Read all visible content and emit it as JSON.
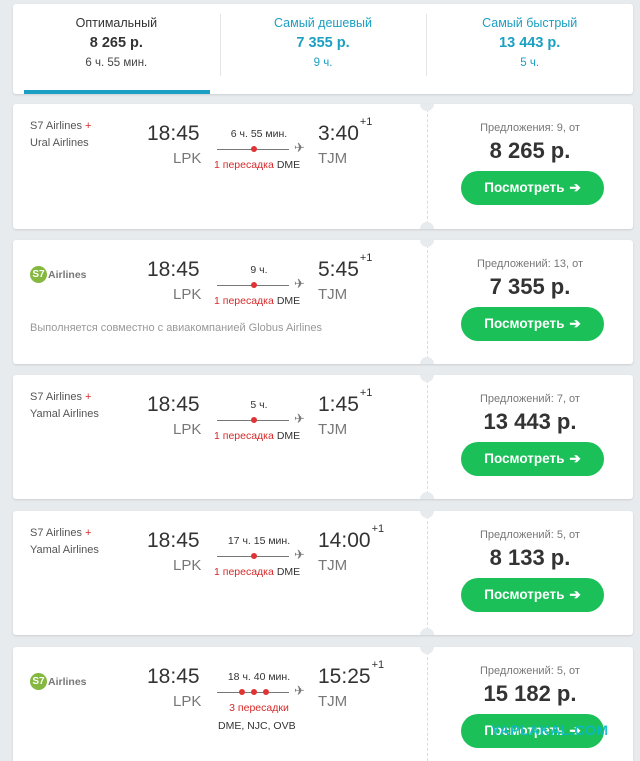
{
  "tabs": [
    {
      "name": "Оптимальный",
      "price": "8 265 р.",
      "duration": "6 ч. 55 мин."
    },
    {
      "name": "Самый дешевый",
      "price": "7 355 р.",
      "duration": "9 ч."
    },
    {
      "name": "Самый быстрый",
      "price": "13 443 р.",
      "duration": "5 ч."
    }
  ],
  "flights": [
    {
      "airline_line1": "S7 Airlines",
      "plus": "+",
      "airline_line2": "Ural Airlines",
      "dep_time": "18:45",
      "dep_code": "LPK",
      "duration": "6 ч. 55 мин.",
      "stops_label": "1 пересадка",
      "stop_code": "DME",
      "arr_time": "3:40",
      "day_offset": "+1",
      "arr_code": "TJM",
      "offers": "Предложения: 9, от",
      "price": "8 265 р.",
      "button": "Посмотреть",
      "arrow": "➔"
    },
    {
      "logo_letter": "S7",
      "logo_text": "Airlines",
      "joint_note": "Выполняется совместно с авиакомпанией Globus Airlines",
      "dep_time": "18:45",
      "dep_code": "LPK",
      "duration": "9 ч.",
      "stops_label": "1 пересадка",
      "stop_code": "DME",
      "arr_time": "5:45",
      "day_offset": "+1",
      "arr_code": "TJM",
      "offers": "Предложений: 13, от",
      "price": "7 355 р.",
      "button": "Посмотреть",
      "arrow": "➔"
    },
    {
      "airline_line1": "S7 Airlines",
      "plus": "+",
      "airline_line2": "Yamal Airlines",
      "dep_time": "18:45",
      "dep_code": "LPK",
      "duration": "5 ч.",
      "stops_label": "1 пересадка",
      "stop_code": "DME",
      "arr_time": "1:45",
      "day_offset": "+1",
      "arr_code": "TJM",
      "offers": "Предложений: 7, от",
      "price": "13 443 р.",
      "button": "Посмотреть",
      "arrow": "➔"
    },
    {
      "airline_line1": "S7 Airlines",
      "plus": "+",
      "airline_line2": "Yamal Airlines",
      "dep_time": "18:45",
      "dep_code": "LPK",
      "duration": "17 ч. 15 мин.",
      "stops_label": "1 пересадка",
      "stop_code": "DME",
      "arr_time": "14:00",
      "day_offset": "+1",
      "arr_code": "TJM",
      "offers": "Предложений: 5, от",
      "price": "8 133 р.",
      "button": "Посмотреть",
      "arrow": "➔"
    },
    {
      "logo_letter": "S7",
      "logo_text": "Airlines",
      "dep_time": "18:45",
      "dep_code": "LPK",
      "duration": "18 ч. 40 мин.",
      "stops_label": "3 пересадки",
      "stop_codes": "DME, NJC, OVB",
      "arr_time": "15:25",
      "day_offset": "+1",
      "arr_code": "TJM",
      "offers": "Предложений: 5, от",
      "price": "15 182 р.",
      "button": "Посмотреть",
      "arrow": "➔",
      "watermark": "YAPLAKAL.COM"
    }
  ],
  "colors": {
    "accent": "#1b9fc2",
    "button": "#1cc059",
    "stops": "#d62929",
    "logo": "#84b840"
  }
}
